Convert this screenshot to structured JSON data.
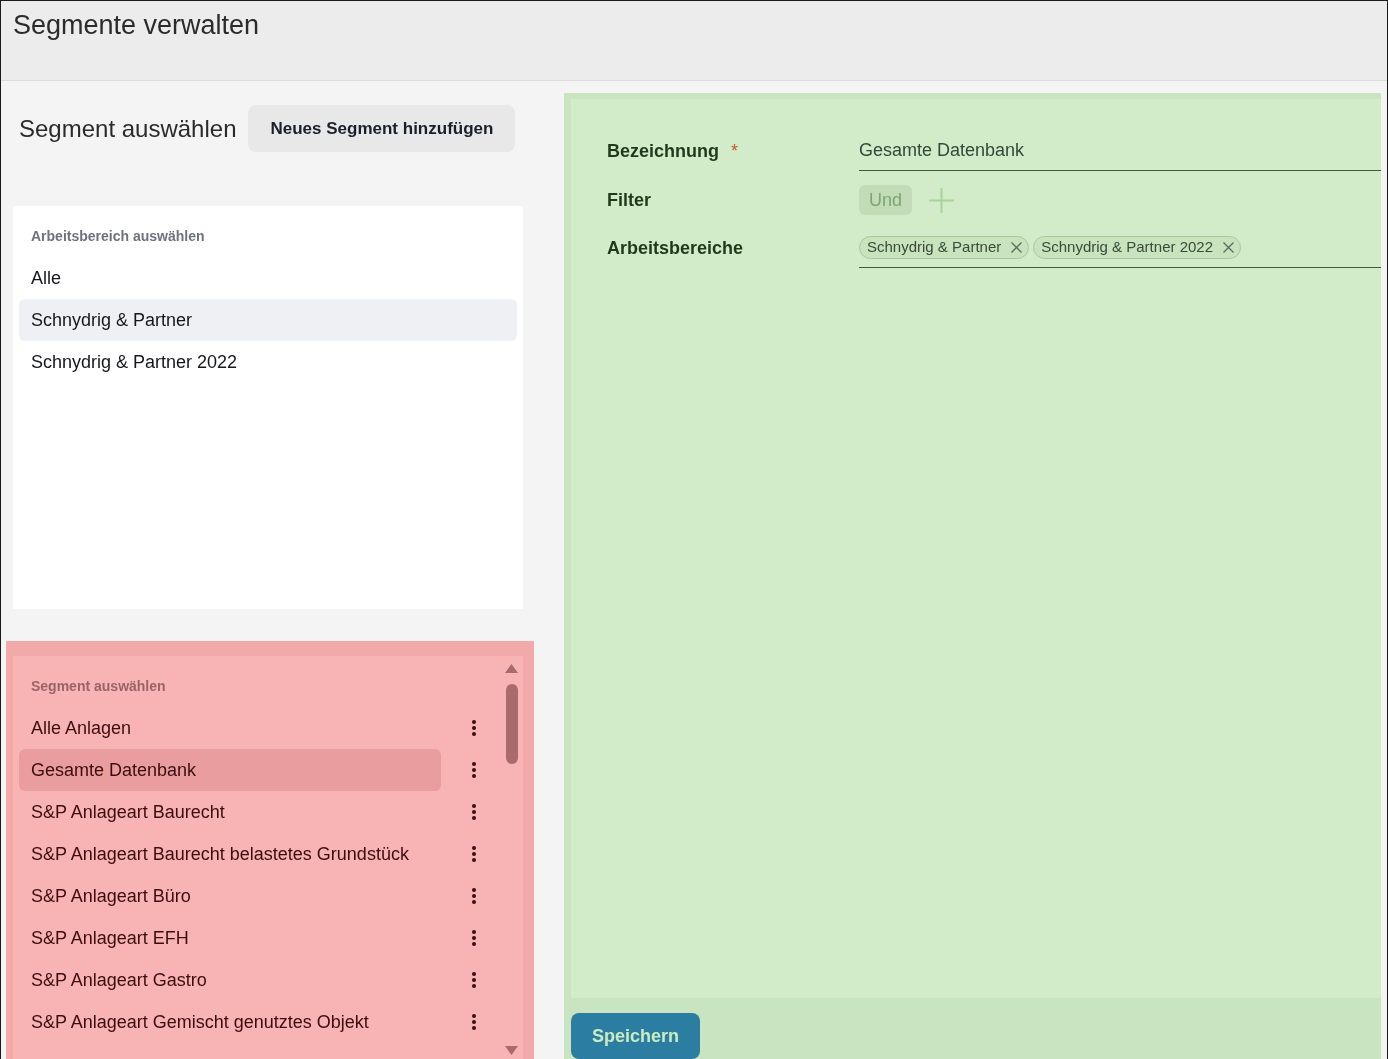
{
  "header": {
    "title": "Segmente verwalten"
  },
  "segment_picker": {
    "heading": "Segment auswählen",
    "add_button": "Neues Segment hinzufügen"
  },
  "workspace_list": {
    "label": "Arbeitsbereich auswählen",
    "items": [
      {
        "label": "Alle",
        "selected": false
      },
      {
        "label": "Schnydrig & Partner",
        "selected": true
      },
      {
        "label": "Schnydrig & Partner 2022",
        "selected": false
      }
    ]
  },
  "segment_list": {
    "label": "Segment auswählen",
    "items": [
      {
        "label": "Alle Anlagen",
        "selected": false
      },
      {
        "label": "Gesamte Datenbank",
        "selected": true
      },
      {
        "label": "S&P Anlageart Baurecht",
        "selected": false
      },
      {
        "label": "S&P Anlageart Baurecht belastetes Grundstück",
        "selected": false
      },
      {
        "label": "S&P Anlageart Büro",
        "selected": false
      },
      {
        "label": "S&P Anlageart EFH",
        "selected": false
      },
      {
        "label": "S&P Anlageart Gastro",
        "selected": false
      },
      {
        "label": "S&P Anlageart Gemischt genutztes Objekt",
        "selected": false
      }
    ]
  },
  "segment_form": {
    "fields": [
      {
        "kind": "text",
        "label": "Bezeichnung",
        "required_mark": "*",
        "value": "Gesamte Datenbank"
      },
      {
        "kind": "filter",
        "label": "Filter",
        "operator": {
          "label": "Und",
          "disabled": true
        }
      },
      {
        "kind": "chips",
        "label": "Arbeitsbereiche",
        "chips": [
          "Schnydrig & Partner",
          "Schnydrig & Partner 2022"
        ]
      }
    ],
    "save_button": "Speichern"
  }
}
